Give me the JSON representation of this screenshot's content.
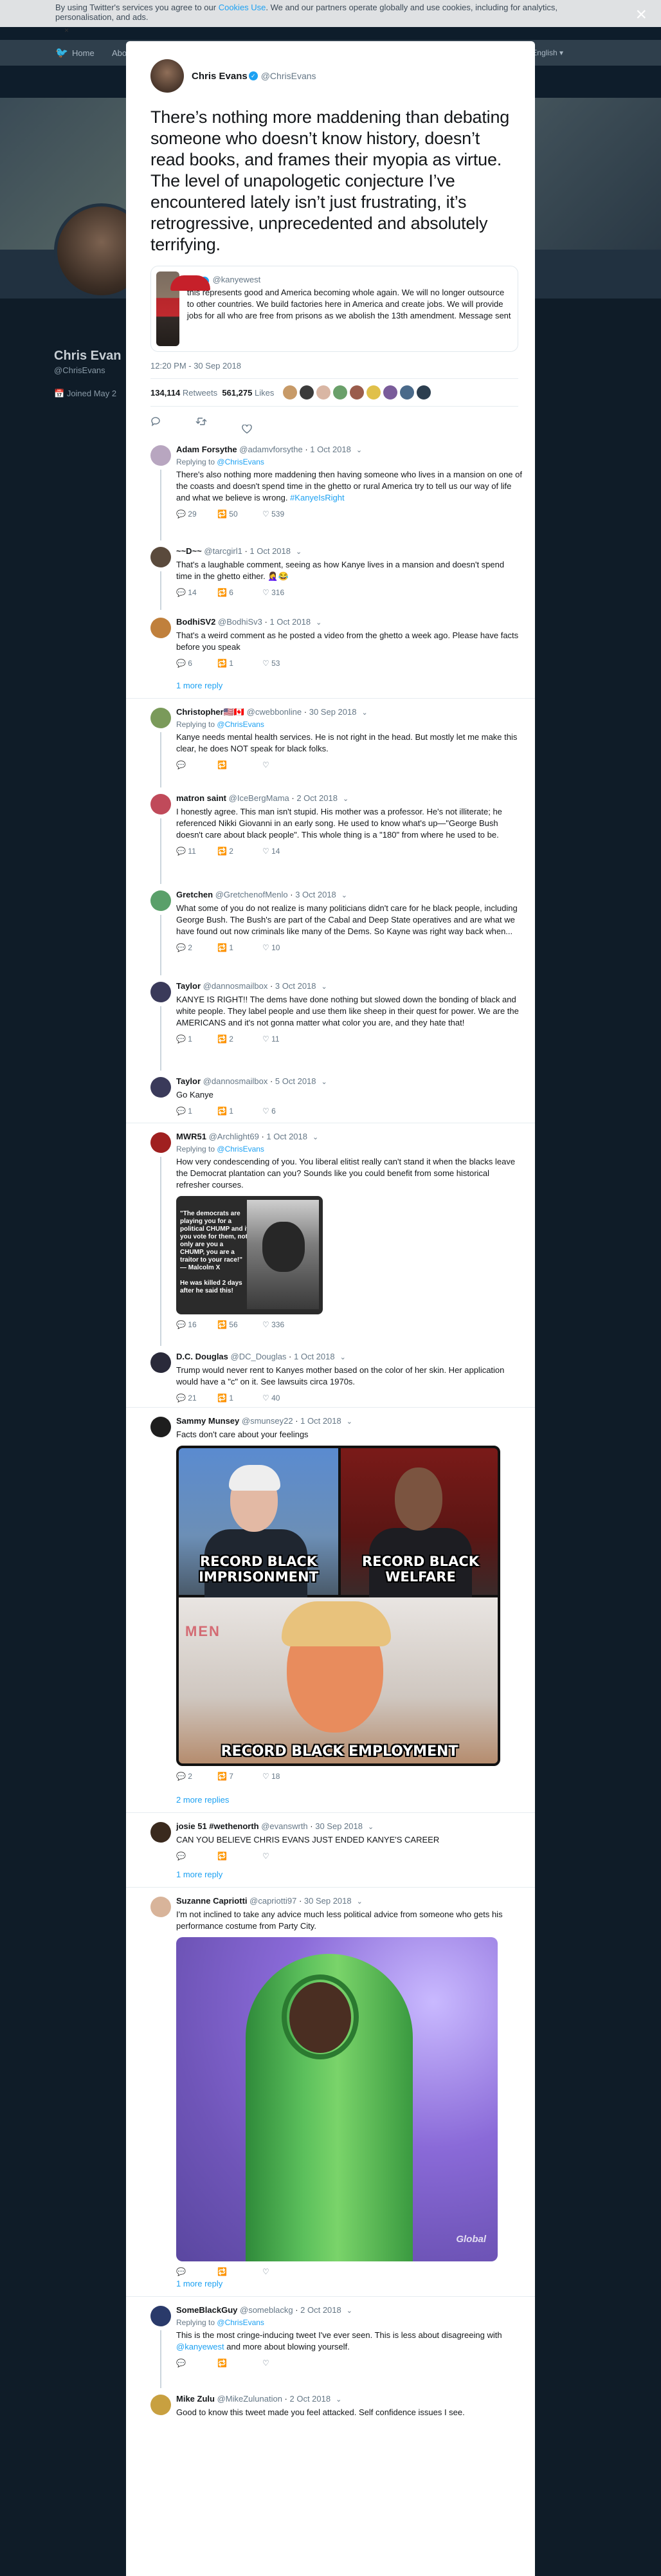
{
  "cookie_bar": {
    "text_before": "By using Twitter's services you agree to our ",
    "link1": "Cookies Use",
    "text_after": ". We and our partners operate globally and use cookies, including for analytics, personalisation, and ads.",
    "close_small": "×",
    "close": "×"
  },
  "background_nav": {
    "home": "Home",
    "about": "Abo",
    "language": "Language: English ▾"
  },
  "background_profile": {
    "name": "Chris Evan",
    "handle": "@ChrisEvans",
    "joined": "Joined May 2"
  },
  "main_tweet": {
    "author_name": "Chris Evans",
    "author_handle": "@ChrisEvans",
    "text": "There’s nothing more maddening than debating someone who doesn’t know history, doesn’t read books, and frames their myopia as virtue. The level of unapologetic conjecture I’ve encountered lately isn’t just frustrating, it’s retrogressive, unprecedented and absolutely terrifying.",
    "quoted": {
      "name": "ye",
      "handle": "@kanyewest",
      "text": "this represents good and America becoming whole again.  We will no longer outsource to other countries. We build factories here in America and create jobs.  We will provide jobs for all who are free from prisons as we abolish the 13th amendment. Message sent"
    },
    "timestamp": "12:20 PM - 30 Sep 2018",
    "retweets_count": "134,114",
    "retweets_label": "Retweets",
    "likes_count": "561,275",
    "likes_label": "Likes"
  },
  "replies": [
    {
      "name": "Adam Forsythe",
      "handle": "@adamvforsythe",
      "time": "1 Oct 2018",
      "replying_to": "@ChrisEvans",
      "text": "There's also nothing more maddening then having someone who lives in a mansion on one of the coasts and doesn't spend time in the ghetto or rural America try to tell us our way of life and what we believe is wrong.",
      "hashtag": "#KanyeIsRight",
      "replies": "29",
      "retweets": "50",
      "likes": "539"
    },
    {
      "name": "~~D~~",
      "handle": "@tarcgirl1",
      "time": "1 Oct 2018",
      "text": "That's a laughable comment, seeing as how Kanye lives in a mansion and doesn't spend time in the ghetto either. 🤦‍♀️😂",
      "replies": "14",
      "retweets": "6",
      "likes": "316"
    },
    {
      "name": "BodhiSV2",
      "handle": "@BodhiSv3",
      "time": "1 Oct 2018",
      "text": "That's a weird comment as he posted a video from the ghetto a week ago. Please have facts before you speak",
      "replies": "6",
      "retweets": "1",
      "likes": "53",
      "more": "1 more reply"
    },
    {
      "name": "Christopher🇺🇸🇨🇦",
      "handle": "@cwebbonline",
      "time": "30 Sep 2018",
      "replying_to": "@ChrisEvans",
      "text": "Kanye needs mental health services. He is not right in the head. But mostly let me make this clear, he does NOT speak for black folks."
    },
    {
      "name": "matron saint",
      "handle": "@IceBergMama",
      "time": "2 Oct 2018",
      "text": "I honestly agree. This man isn't stupid. His mother was a professor. He's not illiterate; he referenced Nikki Giovanni in an early song. He used to know what's up—\"George Bush doesn't care about black people\". This whole thing is a \"180\" from where he used to be.",
      "replies": "11",
      "retweets": "2",
      "likes": "14"
    },
    {
      "name": "Gretchen",
      "handle": "@GretchenofMenlo",
      "time": "3 Oct 2018",
      "text": "What some of you do not realize is many politicians didn't care for he black people, including George Bush. The Bush's are part of the Cabal and Deep State operatives and are what we have found out now criminals like many of the Dems. So Kayne was right way back when...",
      "replies": "2",
      "retweets": "1",
      "likes": "10"
    },
    {
      "name": "Taylor",
      "handle": "@dannosmailbox",
      "time": "3 Oct 2018",
      "text": "KANYE IS RIGHT!! The dems have done nothing but slowed down the bonding of black and white people. They label people and use them like sheep in their quest for power. We are the AMERICANS and it's not gonna matter what color you are, and they hate that!",
      "replies": "1",
      "retweets": "2",
      "likes": "11"
    },
    {
      "name": "Taylor",
      "handle": "@dannosmailbox",
      "time": "5 Oct 2018",
      "text": "Go Kanye",
      "replies": "1",
      "retweets": "1",
      "likes": "6"
    },
    {
      "name": "MWR51",
      "handle": "@Archlight69",
      "time": "1 Oct 2018",
      "replying_to": "@ChrisEvans",
      "text": "How very condescending of you. You liberal elitist really can't stand it when the blacks leave the Democrat plantation can you? Sounds like you could benefit from some historical refresher courses.",
      "image_text": "\"The democrats are playing you for a political CHUMP and if you vote for them, not only are you a CHUMP, you are a traitor to your race!\" — Malcolm X\n\nHe was killed 2 days after he said this!",
      "replies": "16",
      "retweets": "56",
      "likes": "336"
    },
    {
      "name": "D.C. Douglas",
      "handle": "@DC_Douglas",
      "time": "1 Oct 2018",
      "text": "Trump would never rent to Kanyes mother based on the color of her skin. Her application would have a \"c\" on it. See lawsuits circa 1970s.",
      "replies": "21",
      "retweets": "1",
      "likes": "40"
    },
    {
      "name": "Sammy Munsey",
      "handle": "@smunsey22",
      "time": "1 Oct 2018",
      "text": "Facts don't care about your feelings",
      "captions": [
        "RECORD BLACK IMPRISONMENT",
        "RECORD BLACK WELFARE",
        "RECORD BLACK EMPLOYMENT"
      ],
      "replies": "2",
      "retweets": "7",
      "likes": "18",
      "more": "2 more replies"
    },
    {
      "name": "josie 51 #wethenorth",
      "handle": "@evanswrth",
      "time": "30 Sep 2018",
      "text": "CAN YOU BELIEVE CHRIS EVANS JUST ENDED KANYE'S CAREER",
      "more": "1 more reply"
    },
    {
      "name": "Suzanne Capriotti",
      "handle": "@capriotti97",
      "time": "30 Sep 2018",
      "text": "I'm not inclined to take any advice much less political advice from someone who gets his performance costume from Party City.",
      "watermark": "Global",
      "more": "1 more reply"
    },
    {
      "name": "SomeBlackGuy",
      "handle": "@someblackg",
      "time": "2 Oct 2018",
      "replying_to": "@ChrisEvans",
      "text_before": "This is the most cringe-inducing tweet I've ever seen. This is less about disagreeing with ",
      "mention": "@kanyewest",
      "text_after": " and more about blowing yourself."
    },
    {
      "name": "Mike Zulu",
      "handle": "@MikeZulunation",
      "time": "2 Oct 2018",
      "text": "Good to know this tweet made you feel attacked. Self confidence issues I see."
    }
  ],
  "labels": {
    "replying_to": "Replying to"
  },
  "colors": {
    "accent": "#1da1f2",
    "text": "#14171a",
    "muted": "#657786",
    "overlay": "#0e1d2b"
  }
}
